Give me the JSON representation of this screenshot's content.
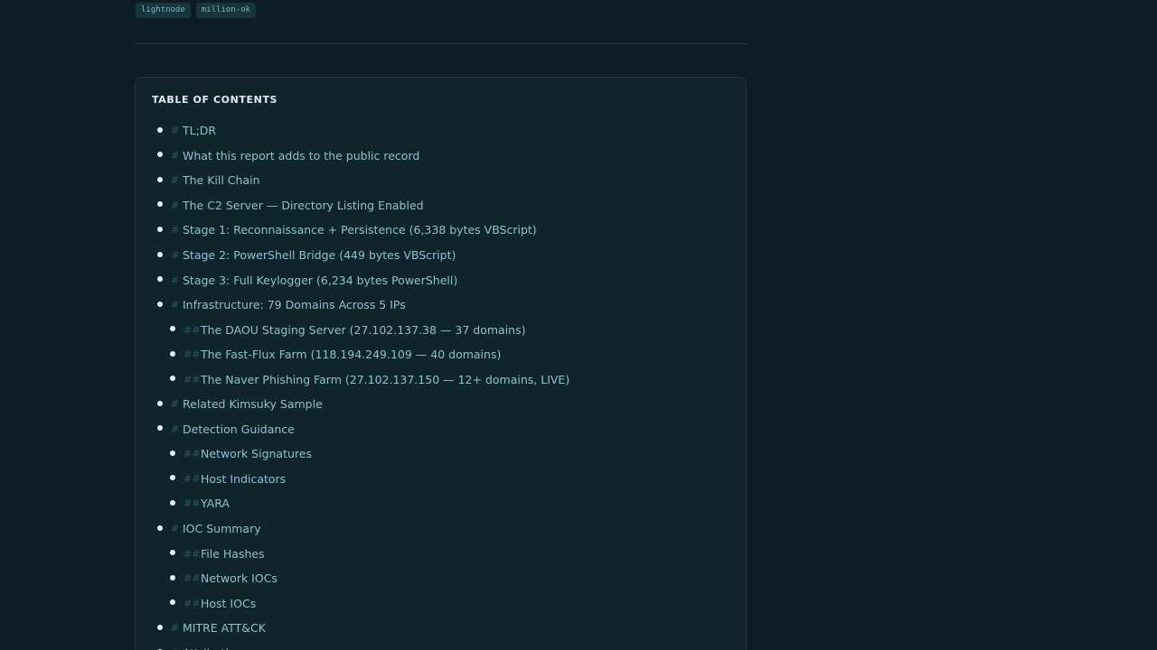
{
  "tags": [
    "lightnode",
    "million-ok"
  ],
  "toc": {
    "title": "TABLE OF CONTENTS",
    "items": [
      {
        "marker": "#",
        "label": "TL;DR",
        "level": 1
      },
      {
        "marker": "#",
        "label": "What this report adds to the public record",
        "level": 1
      },
      {
        "marker": "#",
        "label": "The Kill Chain",
        "level": 1
      },
      {
        "marker": "#",
        "label": "The C2 Server — Directory Listing Enabled",
        "level": 1
      },
      {
        "marker": "#",
        "label": "Stage 1: Reconnaissance + Persistence (6,338 bytes VBScript)",
        "level": 1
      },
      {
        "marker": "#",
        "label": "Stage 2: PowerShell Bridge (449 bytes VBScript)",
        "level": 1
      },
      {
        "marker": "#",
        "label": "Stage 3: Full Keylogger (6,234 bytes PowerShell)",
        "level": 1
      },
      {
        "marker": "#",
        "label": "Infrastructure: 79 Domains Across 5 IPs",
        "level": 1
      },
      {
        "marker": "##",
        "label": "The DAOU Staging Server (27.102.137.38 — 37 domains)",
        "level": 2
      },
      {
        "marker": "##",
        "label": "The Fast-Flux Farm (118.194.249.109 — 40 domains)",
        "level": 2
      },
      {
        "marker": "##",
        "label": "The Naver Phishing Farm (27.102.137.150 — 12+ domains, LIVE)",
        "level": 2
      },
      {
        "marker": "#",
        "label": "Related Kimsuky Sample",
        "level": 1
      },
      {
        "marker": "#",
        "label": "Detection Guidance",
        "level": 1
      },
      {
        "marker": "##",
        "label": "Network Signatures",
        "level": 2
      },
      {
        "marker": "##",
        "label": "Host Indicators",
        "level": 2
      },
      {
        "marker": "##",
        "label": "YARA",
        "level": 2
      },
      {
        "marker": "#",
        "label": "IOC Summary",
        "level": 1
      },
      {
        "marker": "##",
        "label": "File Hashes",
        "level": 2
      },
      {
        "marker": "##",
        "label": "Network IOCs",
        "level": 2
      },
      {
        "marker": "##",
        "label": "Host IOCs",
        "level": 2
      },
      {
        "marker": "#",
        "label": "MITRE ATT&CK",
        "level": 1
      },
      {
        "marker": "#",
        "label": "Attribution",
        "level": 1
      }
    ]
  }
}
